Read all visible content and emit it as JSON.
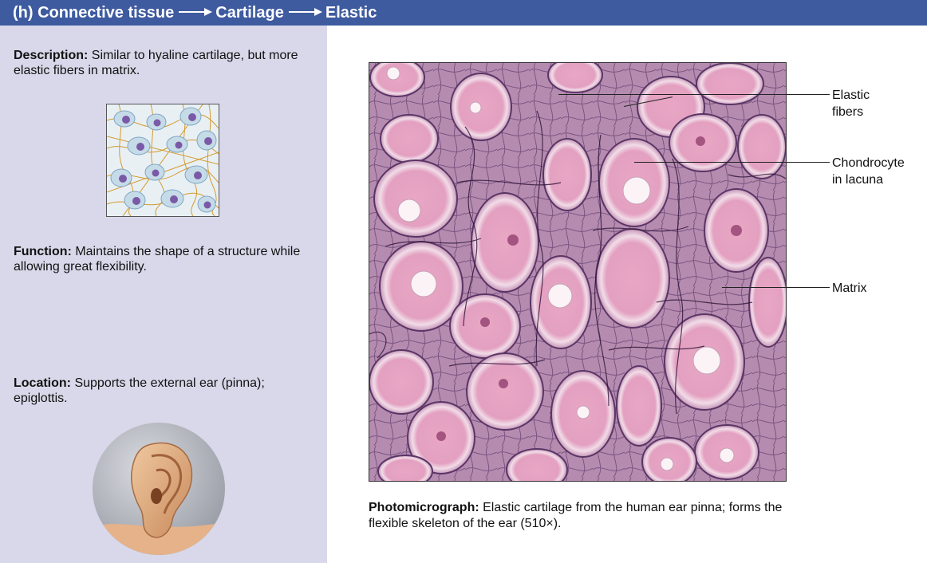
{
  "header": {
    "part1": "(h) Connective tissue",
    "part2": "Cartilage",
    "part3": "Elastic"
  },
  "description": {
    "label": "Description:",
    "text": "Similar to hyaline cartilage, but more elastic fibers in matrix."
  },
  "function": {
    "label": "Function:",
    "text": "Maintains the shape of a structure while allowing great flexibility."
  },
  "location": {
    "label": "Location:",
    "text": "Supports the external ear (pinna); epiglottis."
  },
  "labels": {
    "elastic_fibers_1": "Elastic",
    "elastic_fibers_2": "fibers",
    "chondrocyte_1": "Chondrocyte",
    "chondrocyte_2": "in lacuna",
    "matrix": "Matrix"
  },
  "caption": {
    "label": "Photomicrograph:",
    "text": "Elastic cartilage from the human ear pinna; forms the flexible skeleton of the ear (510×)."
  },
  "colors": {
    "header_bg": "#3e5ba0",
    "sidebar_bg": "#d8d8ea",
    "tissue_pink": "#e7a5c4",
    "fiber_purple": "#3b1a4a"
  }
}
